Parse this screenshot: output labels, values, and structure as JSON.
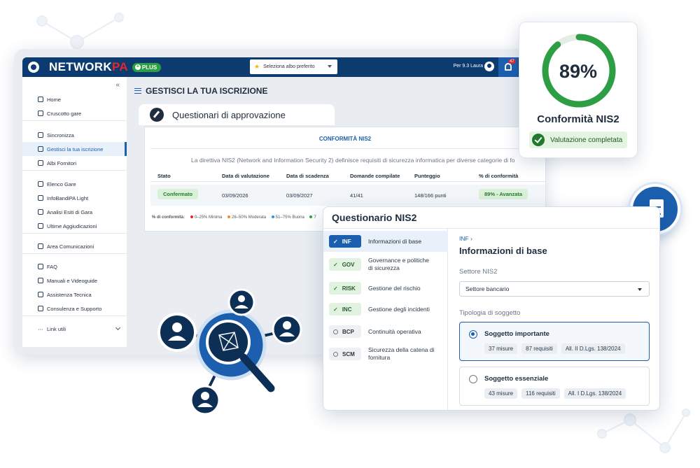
{
  "app": {
    "brand_main": "NETWORK",
    "brand_accent": "PA",
    "plus_label": "PLUS",
    "albo_placeholder": "Seleziona albo preferito",
    "user_label": "Per 9.3 Laura",
    "notification_count": "47"
  },
  "sidebar": {
    "groups": [
      [
        "Home",
        "Cruscotto gare"
      ],
      [
        "Sincronizza",
        "Gestisci la tua iscrizione",
        "Albi Fornitori"
      ],
      [
        "Elenco Gare",
        "InfoBandiPA Light",
        "Analisi Esiti di Gara",
        "Ultime Aggiudicazioni"
      ],
      [
        "Area Comunicazioni"
      ],
      [
        "FAQ",
        "Manuali e Videoguide",
        "Assistenza Tecnica",
        "Consulenza e Supporto"
      ],
      [
        "Link utili"
      ]
    ]
  },
  "page": {
    "title": "GESTISCI LA TUA ISCRIZIONE",
    "tab_title": "Questionari di approvazione",
    "panel_title": "CONFORMITÀ NIS2",
    "panel_desc": "La direttiva NIS2 (Network and Information Security 2) definisce requisiti di sicurezza informatica per diverse categorie di fo",
    "table": {
      "headers": [
        "Stato",
        "Data di valutazione",
        "Data di scadenza",
        "Domande compilate",
        "Punteggio",
        "% di conformità"
      ],
      "row": {
        "stato": "Confermato",
        "valutazione": "03/09/2026",
        "scadenza": "03/09/2027",
        "domande": "41/41",
        "punteggio": "148/166 punti",
        "conformita": "89% - Avanzata"
      }
    },
    "legend": {
      "label": "% di conformità:",
      "items": [
        "0–25% Minima",
        "26–50% Moderata",
        "51–75% Buona",
        "7"
      ]
    }
  },
  "conformity": {
    "value": "89%",
    "percent": 89,
    "title": "Conformità NIS2",
    "badge": "Valutazione completata"
  },
  "questionnaire": {
    "title": "Questionario NIS2",
    "steps": [
      {
        "code": "INF",
        "label": "Informazioni di base",
        "state": "current"
      },
      {
        "code": "GOV",
        "label": "Governance e politiche di sicurezza",
        "state": "done"
      },
      {
        "code": "RISK",
        "label": "Gestione del rischio",
        "state": "done"
      },
      {
        "code": "INC",
        "label": "Gestione degli incidenti",
        "state": "done"
      },
      {
        "code": "BCP",
        "label": "Continuità operativa",
        "state": "todo"
      },
      {
        "code": "SCM",
        "label": "Sicurezza della catena di fornitura",
        "state": "todo"
      }
    ],
    "breadcrumb": "INF",
    "section_title": "Informazioni di base",
    "settore_label": "Settore NIS2",
    "settore_value": "Settore bancario",
    "tipologia_label": "Tipologia di soggetto",
    "options": [
      {
        "name": "Soggetto importante",
        "tags": [
          "37 misure",
          "87 requisiti",
          "All. II D.Lgs. 138/2024"
        ],
        "selected": true
      },
      {
        "name": "Soggetto essenziale",
        "tags": [
          "43 misure",
          "116 requisiti",
          "All. I D.Lgs. 138/2024"
        ],
        "selected": false
      }
    ]
  },
  "colors": {
    "navy": "#0b3b6f",
    "brand_blue": "#1b5fae",
    "accent_red": "#e3262f",
    "success_green": "#2e9e45"
  }
}
